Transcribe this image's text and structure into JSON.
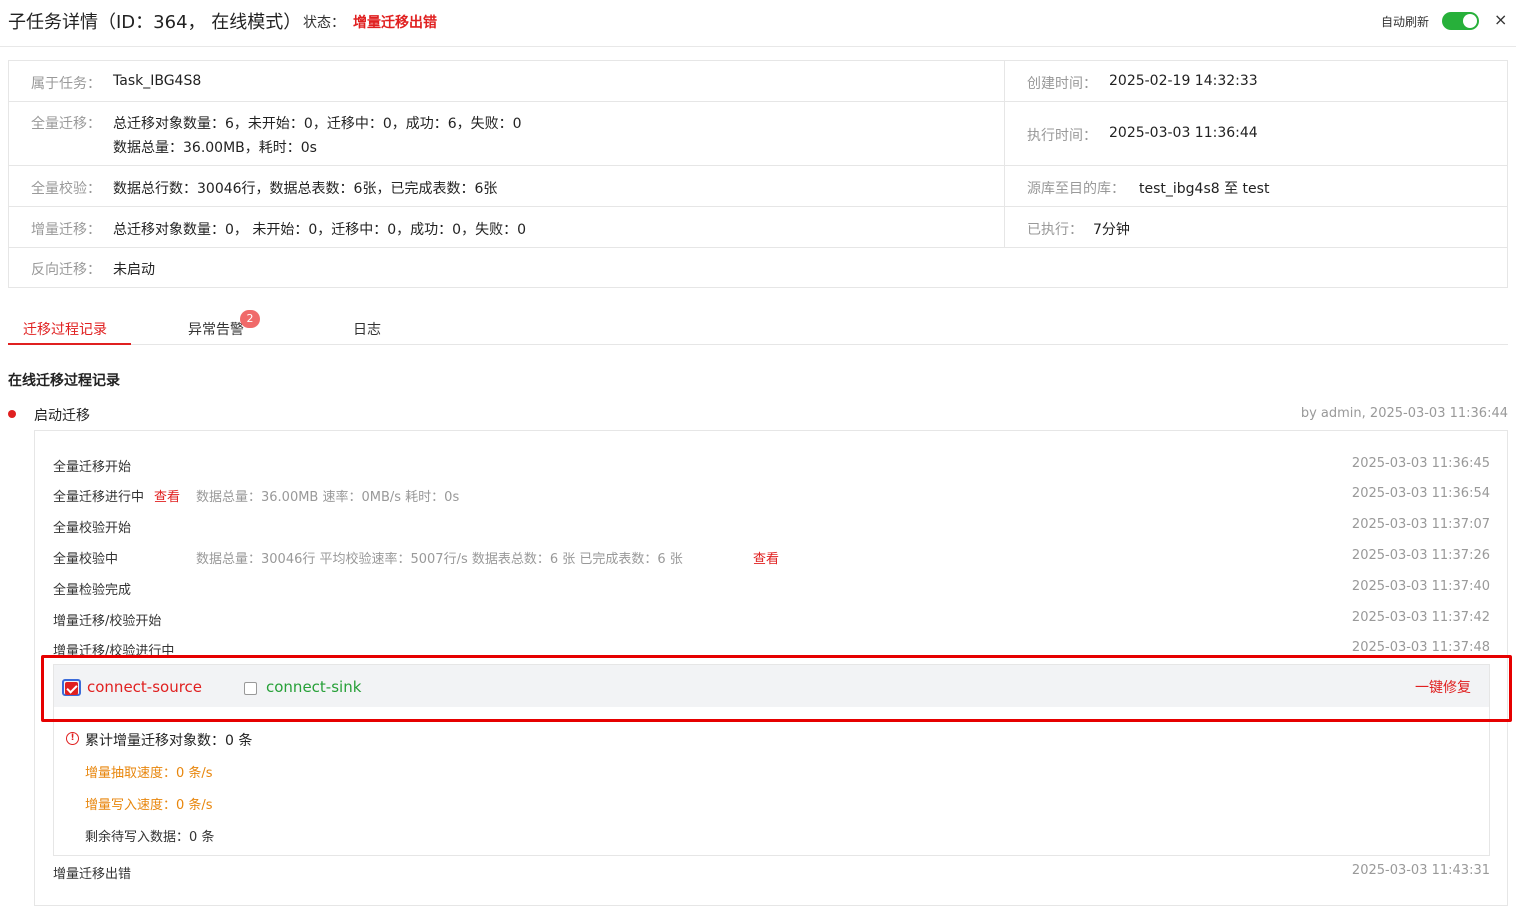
{
  "header": {
    "title": "子任务详情（ID：364，  在线模式）",
    "status_label": "状态：",
    "status_value": "增量迁移出错",
    "auto_refresh_label": "自动刷新",
    "auto_refresh_on": true,
    "close": "×"
  },
  "info": {
    "task_label": "属于任务：",
    "task_value": "Task_IBG4S8",
    "full_migration_label": "全量迁移：",
    "full_migration_line1": "总迁移对象数量：6，未开始：0，迁移中：0，成功：6，失败：0",
    "full_migration_line2": "数据总量：36.00MB，耗时：0s",
    "full_check_label": "全量校验：",
    "full_check_value": "数据总行数：30046行，数据总表数：6张，已完成表数：6张",
    "incr_migration_label": "增量迁移：",
    "incr_migration_value": "总迁移对象数量：0，  未开始：0，迁移中：0，成功：0，失败：0",
    "reverse_label": "反向迁移：",
    "reverse_value": "未启动",
    "created_label": "创建时间：",
    "created_value": "2025-02-19 14:32:33",
    "exec_time_label": "执行时间：",
    "exec_time_value": "2025-03-03 11:36:44",
    "src_dst_label": "源库至目的库：",
    "src_dst_value": "test_ibg4s8 至 test",
    "elapsed_label": "已执行：",
    "elapsed_value": "7分钟"
  },
  "tabs": [
    {
      "label": "迁移过程记录",
      "active": true
    },
    {
      "label": "异常告警",
      "badge": "2"
    },
    {
      "label": "日志"
    }
  ],
  "section_title": "在线迁移过程记录",
  "step": {
    "title": "启动迁移",
    "meta": "by admin, 2025-03-03 11:36:44"
  },
  "events": [
    {
      "name": "全量迁移开始",
      "time": "2025-03-03 11:36:45"
    },
    {
      "name": "全量迁移进行中",
      "link": "查看",
      "detail": "数据总量：36.00MB   速率：0MB/s   耗时：0s",
      "time": "2025-03-03 11:36:54"
    },
    {
      "name": "全量校验开始",
      "time": "2025-03-03 11:37:07"
    },
    {
      "name": "全量校验中",
      "detail": "数据总量：30046行   平均校验速率：5007行/s   数据表总数：6 张   已完成表数：6 张",
      "link": "查看",
      "time": "2025-03-03 11:37:26"
    },
    {
      "name": "全量检验完成",
      "time": "2025-03-03 11:37:40"
    },
    {
      "name": "增量迁移/校验开始",
      "time": "2025-03-03 11:37:42"
    },
    {
      "name": "增量迁移/校验进行中",
      "time": "2025-03-03 11:37:48"
    },
    {
      "name": "增量迁移出错",
      "time": "2025-03-03 11:43:31"
    }
  ],
  "connectors": {
    "source_label": "connect-source",
    "source_checked": true,
    "source_color": "#e02020",
    "sink_label": "connect-sink",
    "sink_checked": false,
    "sink_color": "#27a038",
    "fix_label": "一键修复"
  },
  "stats": {
    "total_label": "累计增量迁移对象数：0 条",
    "extract_speed": "增量抽取速度：0 条/s",
    "write_speed": "增量写入速度：0 条/s",
    "remaining": "剩余待写入数据：0 条",
    "speed_color": "#e8860c"
  }
}
